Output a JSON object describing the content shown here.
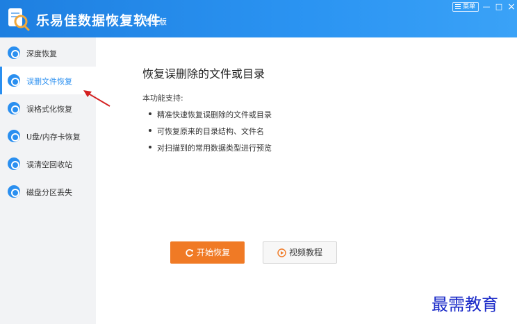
{
  "app": {
    "title": "乐易佳数据恢复软件",
    "edition": "专业版"
  },
  "window": {
    "menu_label": "菜单",
    "minimize": "—",
    "maximize": "□",
    "close": "×"
  },
  "sidebar": {
    "items": [
      {
        "label": "深度恢复",
        "active": false
      },
      {
        "label": "误删文件恢复",
        "active": true
      },
      {
        "label": "误格式化恢复",
        "active": false
      },
      {
        "label": "U盘/内存卡恢复",
        "active": false
      },
      {
        "label": "误清空回收站",
        "active": false
      },
      {
        "label": "磁盘分区丢失",
        "active": false
      }
    ]
  },
  "main": {
    "heading": "恢复误删除的文件或目录",
    "support_label": "本功能支持:",
    "features": [
      "精准快速恢复误删除的文件或目录",
      "可恢复原来的目录结构、文件名",
      "对扫描到的常用数据类型进行预览"
    ],
    "start_button": "开始恢复",
    "video_button": "视频教程"
  },
  "watermark": "最需教育",
  "colors": {
    "titlebar": "#2b94f2",
    "accent": "#2a8ff0",
    "start_button": "#f07a25",
    "arrow": "#d42020",
    "watermark": "#1a2ac8"
  }
}
